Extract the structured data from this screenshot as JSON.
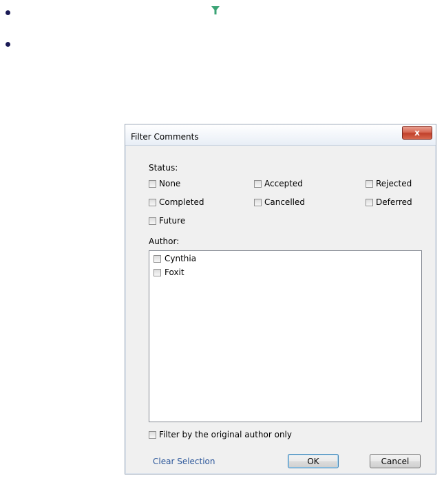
{
  "dialog": {
    "title": "Filter Comments",
    "close_label": "x",
    "status_label": "Status:",
    "status_options": [
      "None",
      "Accepted",
      "Rejected",
      "Completed",
      "Cancelled",
      "Deferred",
      "Future"
    ],
    "author_label": "Author:",
    "authors": [
      "Cynthia",
      "Foxit"
    ],
    "original_author_label": "Filter by the original author only",
    "clear_selection": "Clear Selection",
    "ok": "OK",
    "cancel": "Cancel"
  },
  "colors": {
    "funnel": "#3aa374",
    "link": "#2a5599",
    "close": "#c1402b"
  }
}
